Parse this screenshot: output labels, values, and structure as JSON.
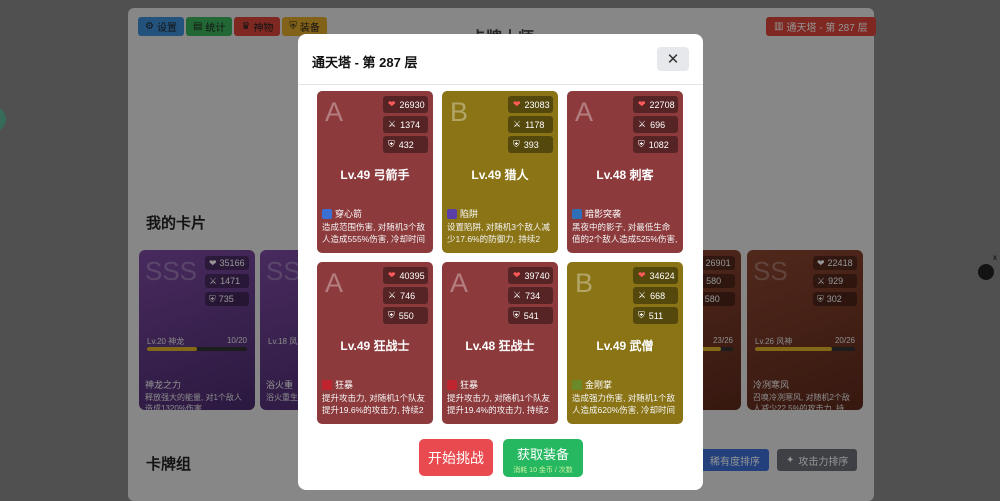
{
  "app": {
    "title": "卡牌大师"
  },
  "nav": [
    {
      "label": "设置",
      "icon": "gear-icon",
      "color": "#3d8fd8"
    },
    {
      "label": "统计",
      "icon": "chart-icon",
      "color": "#3bb35b"
    },
    {
      "label": "神物",
      "icon": "trophy-icon",
      "color": "#d9463a"
    },
    {
      "label": "装备",
      "icon": "shield-icon",
      "color": "#e0a82a"
    }
  ],
  "floor_badge": "通天塔 - 第 287 层",
  "sections": {
    "my_cards": "我的卡片",
    "deck": "卡牌组"
  },
  "bg_cards": [
    {
      "grade": "SSS",
      "hp": "35166",
      "atk": "1471",
      "def": "735",
      "level": "Lv.20 神龙",
      "progress": "10/20",
      "progress_value": 0.5,
      "skill": "神龙之力",
      "desc": "释放强大的能量, 对1个敌人造成1320%伤害",
      "color": "#6a3d8c"
    },
    {
      "grade": "SS",
      "hp": "",
      "atk": "",
      "def": "",
      "level": "Lv.18 凤凰",
      "progress": "",
      "progress_value": 0.4,
      "skill": "浴火重",
      "desc": "浴火重生, 命值的2",
      "color": "#6a3d8c"
    },
    {
      "grade": "",
      "hp": "26901",
      "atk": "580",
      "def": "580",
      "level": "",
      "progress": "23/26",
      "progress_value": 0.88,
      "skill": "",
      "desc": "1个敌人",
      "color": "#7a3c2a"
    },
    {
      "grade": "SS",
      "hp": "22418",
      "atk": "929",
      "def": "302",
      "level": "Lv.26 风神",
      "progress": "20/26",
      "progress_value": 0.77,
      "skill": "冷冽寒风",
      "desc": "召唤冷冽寒风, 对随机2个敌人减少22.5%的攻击力, 持续...",
      "color": "#7a3c2a"
    }
  ],
  "sort_buttons": [
    {
      "label": "稀有度排序",
      "color": "#3d6fd8"
    },
    {
      "label": "攻击力排序",
      "color": "#6b6f78"
    }
  ],
  "modal": {
    "title": "通天塔 - 第 287 层",
    "close_icon": "close-icon",
    "start_label": "开始挑战",
    "gear_label": "获取装备",
    "gear_sub": "消耗 10 金币 / 次数",
    "cards": [
      {
        "grade": "A",
        "hp": "26930",
        "atk": "1374",
        "def": "432",
        "name": "Lv.49 弓箭手",
        "skill": "穿心箭",
        "desc": "造成范围伤害, 对随机3个敌人造成555%伤害, 冷却时间1...",
        "color": "#8c3a3c",
        "icon": "arrow-icon"
      },
      {
        "grade": "B",
        "hp": "23083",
        "atk": "1178",
        "def": "393",
        "name": "Lv.49 猎人",
        "skill": "陷阱",
        "desc": "设置陷阱, 对随机3个敌人减少17.6%的防御力, 持续2回...",
        "color": "#8a7416",
        "icon": "trap-icon"
      },
      {
        "grade": "A",
        "hp": "22708",
        "atk": "696",
        "def": "1082",
        "name": "Lv.48 刺客",
        "skill": "暗影突袭",
        "desc": "黑夜中的影子, 对最低生命值的2个敌人造成525%伤害, ...",
        "color": "#8c3a3c",
        "icon": "shadow-icon"
      },
      {
        "grade": "A",
        "hp": "40395",
        "atk": "746",
        "def": "550",
        "name": "Lv.49 狂战士",
        "skill": "狂暴",
        "desc": "提升攻击力, 对随机1个队友提升19.6%的攻击力, 持续2回...",
        "color": "#8c3a3c",
        "icon": "rage-icon"
      },
      {
        "grade": "A",
        "hp": "39740",
        "atk": "734",
        "def": "541",
        "name": "Lv.48 狂战士",
        "skill": "狂暴",
        "desc": "提升攻击力, 对随机1个队友提升19.4%的攻击力, 持续2回...",
        "color": "#8c3a3c",
        "icon": "rage-icon"
      },
      {
        "grade": "B",
        "hp": "34624",
        "atk": "668",
        "def": "511",
        "name": "Lv.49 武僧",
        "skill": "金刚掌",
        "desc": "造成强力伤害, 对随机1个敌人造成620%伤害, 冷却时间1...",
        "color": "#8a7416",
        "icon": "palm-icon"
      }
    ]
  }
}
